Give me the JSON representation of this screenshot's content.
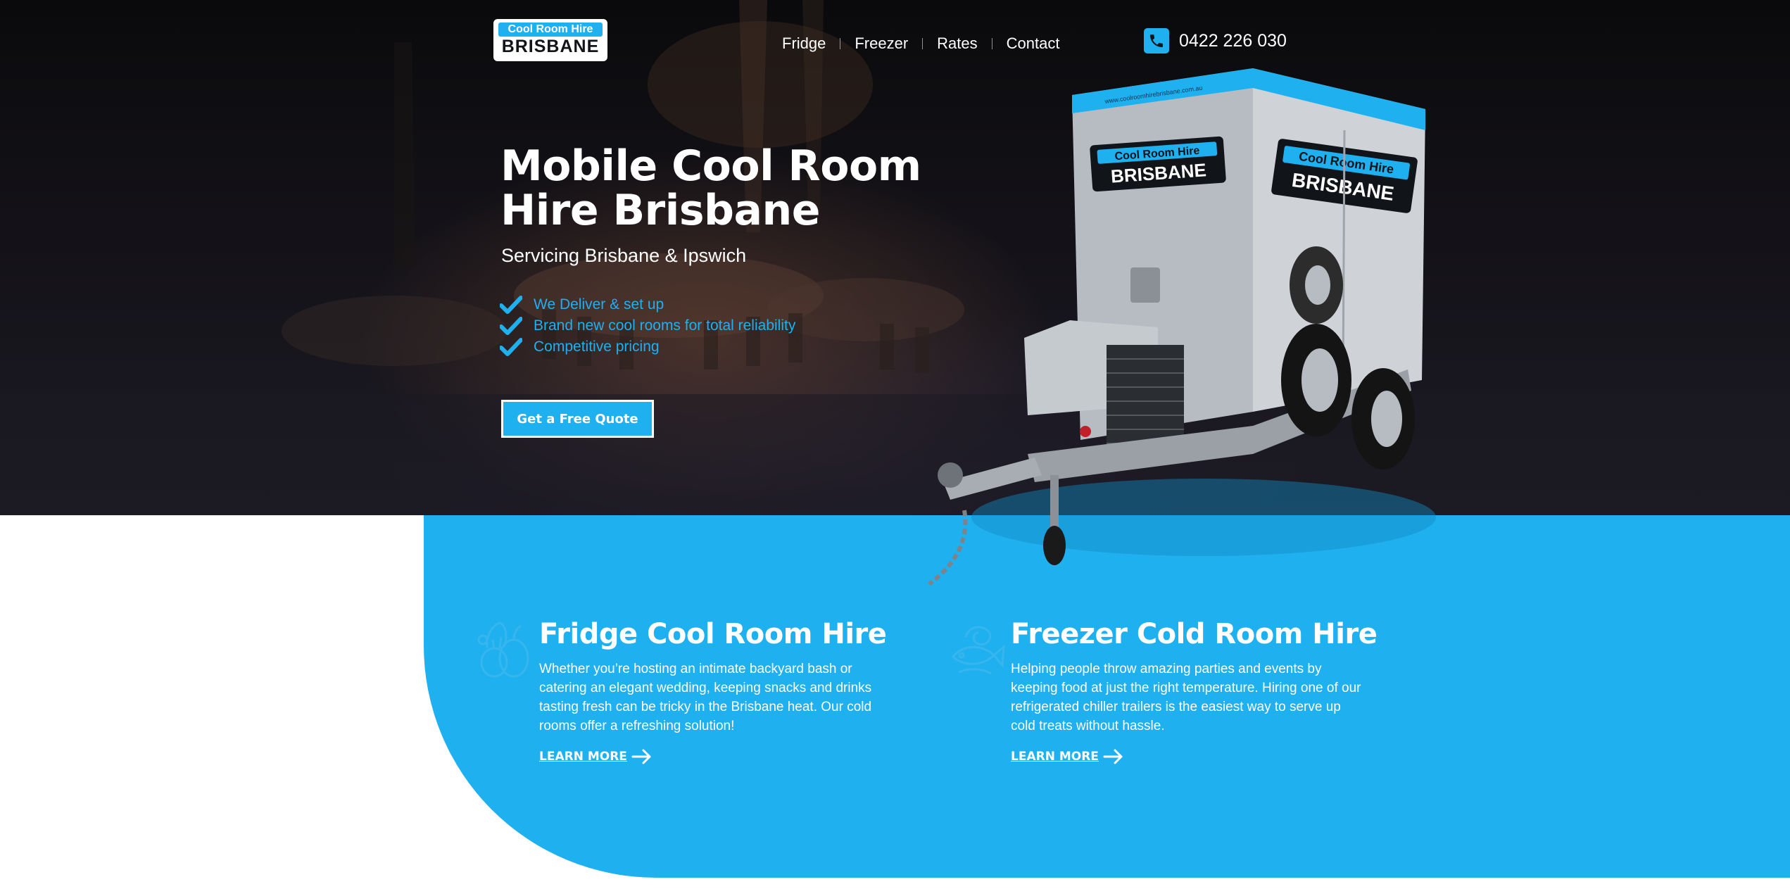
{
  "logo": {
    "top": "Cool Room Hire",
    "bottom": "BRISBANE"
  },
  "nav": {
    "items": [
      "Fridge",
      "Freezer",
      "Rates",
      "Contact"
    ]
  },
  "phone": {
    "number": "0422 226 030",
    "icon": "phone-icon"
  },
  "hero": {
    "title": "Mobile Cool Room Hire Brisbane",
    "subtitle": "Servicing Brisbane & Ipswich",
    "features": [
      "We Deliver & set up",
      "Brand new cool rooms for total reliability",
      "Competitive pricing"
    ],
    "cta": "Get a Free Quote"
  },
  "trailer": {
    "sign_top": "Cool Room Hire",
    "sign_bottom": "BRISBANE",
    "url": "www.coolroomhirebrisbane.com.au"
  },
  "cards": [
    {
      "title": "Fridge Cool Room Hire",
      "text": "Whether you’re hosting an intimate backyard bash or catering an elegant wedding, keeping snacks and drinks tasting fresh can be tricky in the Brisbane heat. Our cold rooms offer a refreshing solution!",
      "link": "LEARN MORE",
      "icon": "produce-icon"
    },
    {
      "title": "Freezer Cold Room Hire",
      "text": "Helping people throw amazing parties and events by keeping food at just the right temperature. Hiring one of our refrigerated chiller trailers is the easiest way to serve up cold treats without hassle.",
      "link": "LEARN MORE",
      "icon": "seafood-icon"
    }
  ],
  "colors": {
    "accent": "#1fb0f0",
    "dark": "#0a0a0c",
    "white": "#ffffff"
  }
}
